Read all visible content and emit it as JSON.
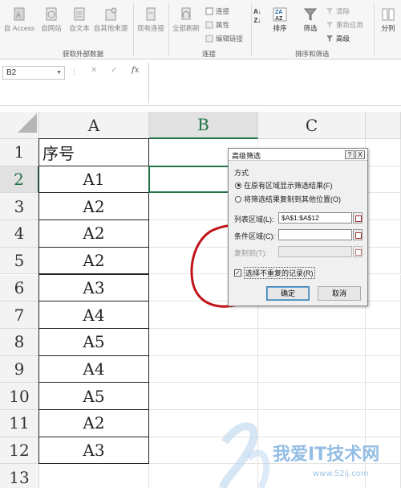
{
  "ribbon": {
    "buttons": [
      {
        "label": "自 Access",
        "icon": "access-icon"
      },
      {
        "label": "自网站",
        "icon": "web-icon"
      },
      {
        "label": "自文本",
        "icon": "text-file-icon"
      },
      {
        "label": "自其他来源",
        "icon": "other-sources-icon"
      },
      {
        "label": "现有连接",
        "icon": "existing-connections-icon"
      },
      {
        "label": "全部刷新",
        "icon": "refresh-all-icon"
      }
    ],
    "connections": [
      "连接",
      "属性",
      "编辑链接"
    ],
    "sort_label": "排序",
    "filter_label": "筛选",
    "filter_small": [
      "清除",
      "重新应用",
      "高级"
    ],
    "split_label": "分列",
    "group_labels": {
      "external_data": "获取外部数据",
      "connections": "连接",
      "sort_filter": "排序和筛选"
    }
  },
  "formula_bar": {
    "name_box": "B2",
    "fx": "fx",
    "value": ""
  },
  "columns": [
    "A",
    "B",
    "C"
  ],
  "active_cell": "B2",
  "rows": [
    {
      "num": "1",
      "a": "序号"
    },
    {
      "num": "2",
      "a": "A1"
    },
    {
      "num": "3",
      "a": "A2"
    },
    {
      "num": "4",
      "a": "A2"
    },
    {
      "num": "5",
      "a": "A2"
    },
    {
      "num": "6",
      "a": "A3"
    },
    {
      "num": "7",
      "a": "A4"
    },
    {
      "num": "8",
      "a": "A5"
    },
    {
      "num": "9",
      "a": "A4"
    },
    {
      "num": "10",
      "a": "A5"
    },
    {
      "num": "11",
      "a": "A2"
    },
    {
      "num": "12",
      "a": "A3"
    },
    {
      "num": "13",
      "a": ""
    }
  ],
  "dialog": {
    "title": "高级筛选",
    "help": "?",
    "close": "X",
    "method_label": "方式",
    "radio_inplace": "在原有区域显示筛选结果(F)",
    "radio_copy": "将筛选结果复制到其他位置(O)",
    "list_range_label": "列表区域(L):",
    "list_range_value": "$A$1:$A$12",
    "criteria_label": "条件区域(C):",
    "criteria_value": "",
    "copy_to_label": "复制到(T):",
    "copy_to_value": "",
    "unique_label": "选择不重复的记录(R)",
    "unique_checked": true,
    "ok": "确定",
    "cancel": "取消"
  },
  "annotation": {
    "color": "#c0141a"
  },
  "watermark": {
    "text": "我爱IT技术网",
    "url": "www.52ij.com"
  },
  "accent": "#217346"
}
